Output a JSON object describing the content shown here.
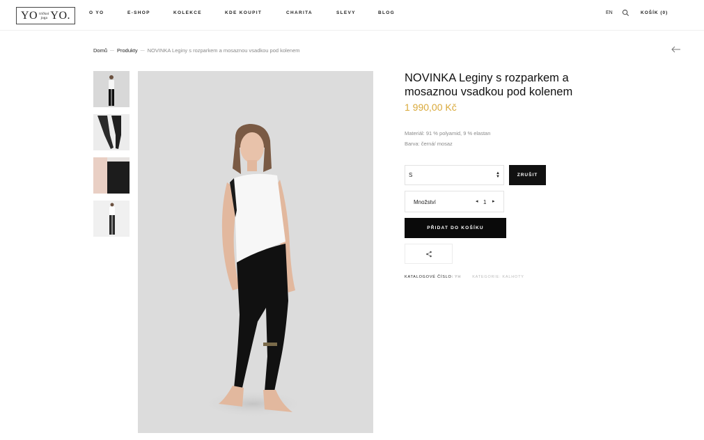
{
  "header": {
    "logo": {
      "left": "YO",
      "mid_top": "tričkoí",
      "mid_bottom": "joga",
      "right": "YO."
    },
    "nav": [
      "O YO",
      "E-SHOP",
      "KOLEKCE",
      "KDE KOUPIT",
      "CHARITA",
      "SLEVY",
      "BLOG"
    ],
    "lang": "EN",
    "cart_label": "KOŠÍK (0)"
  },
  "breadcrumb": [
    "Domů",
    "Produkty",
    "NOVINKA Leginy s rozparkem a mosaznou vsadkou pod kolenem"
  ],
  "product": {
    "title": "NOVINKA Leginy s rozparkem a mosaznou vsadkou pod kolenem",
    "price": "1 990,00 Kč",
    "material": "Materiál: 91 % polyamid, 9 % elastan",
    "color": "Barva: černá/ mosaz",
    "size_selected": "S",
    "clear_label": "ZRUŠIT",
    "quantity_label": "Množství",
    "quantity": "1",
    "add_to_cart_label": "PŘIDAT DO KOŠÍKU",
    "sku_label": "KATALOGOVÉ ČÍSLO:",
    "sku_value": "YH",
    "category_label": "KATEGORIE:",
    "category_value": "KALHOTY"
  },
  "colors": {
    "accent_price": "#d9a93a",
    "button_dark": "#111111"
  },
  "icons": [
    "search-icon",
    "back-arrow-icon",
    "share-icon",
    "select-arrows-icon",
    "quantity-decrease-icon",
    "quantity-increase-icon"
  ]
}
